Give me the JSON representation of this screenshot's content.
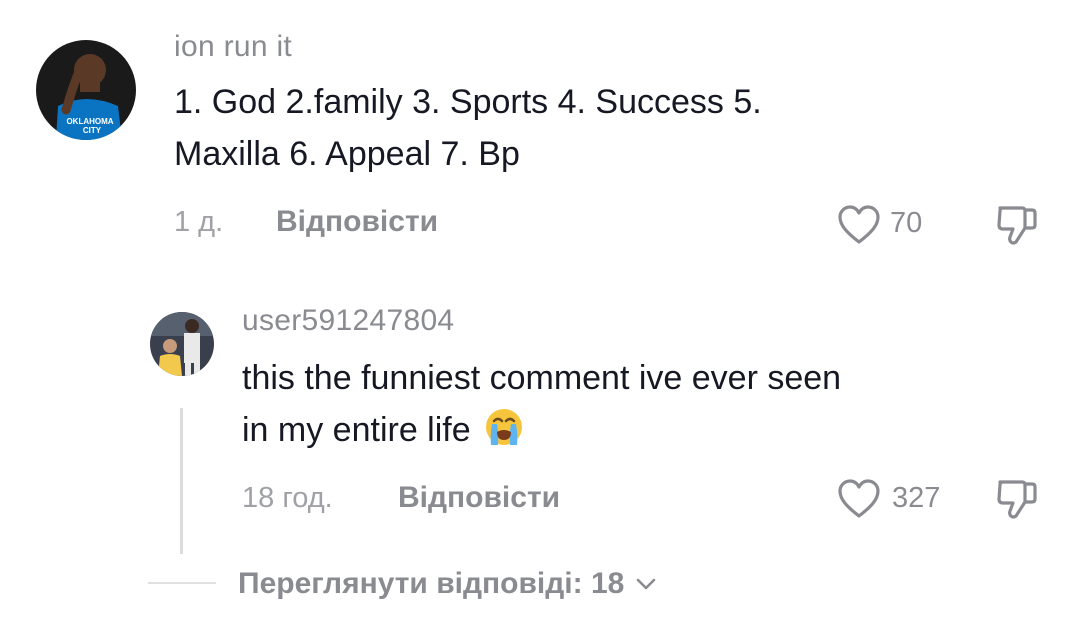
{
  "comments": [
    {
      "username": "ion run it",
      "text_line1": "1. God 2.family 3. Sports 4. Success 5.",
      "text_line2": "Maxilla 6. Appeal 7. Bp",
      "time": "1 д.",
      "reply_label": "Відповісти",
      "likes": "70",
      "avatar_jersey_text": "OKLAHOMA CITY"
    },
    {
      "username": "user591247804",
      "text_line1": "this the funniest comment ive ever seen",
      "text_line2": "in my entire life",
      "emoji": "😭",
      "time": "18 год.",
      "reply_label": "Відповісти",
      "likes": "327"
    }
  ],
  "view_replies": {
    "label": "Переглянути відповіді: 18",
    "icon": "chevron-down-icon"
  },
  "icons": {
    "like": "heart-outline-icon",
    "dislike": "thumbs-down-icon"
  },
  "colors": {
    "text": "#161823",
    "muted": "#8a8b91",
    "jersey": "#0a74c2"
  }
}
